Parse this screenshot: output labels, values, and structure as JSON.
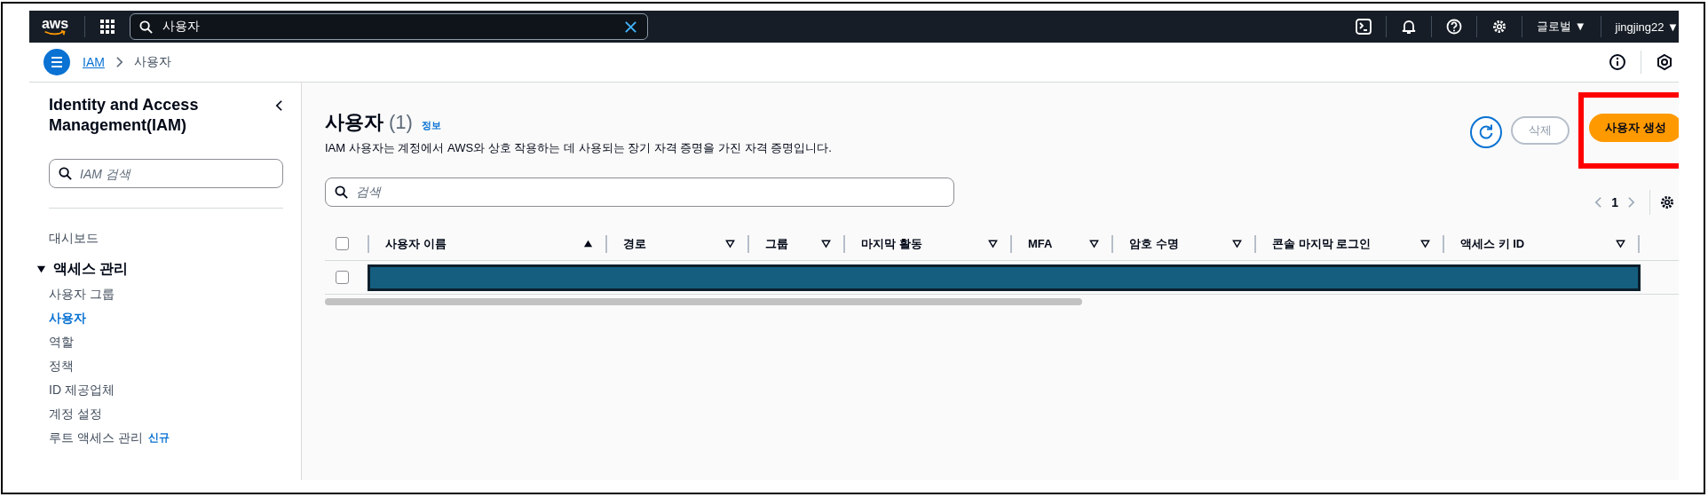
{
  "top_bar": {
    "logo": "aws",
    "search": {
      "value": "사용자"
    },
    "region": "글로벌 ▼",
    "user": "jingjing22 ▼"
  },
  "breadcrumb": {
    "items": [
      {
        "label": "IAM",
        "link": true
      },
      {
        "label": "사용자",
        "link": false
      }
    ]
  },
  "sidebar": {
    "title": "Identity and Access Management(IAM)",
    "search": {
      "placeholder": "IAM 검색"
    },
    "items": [
      {
        "label": "대시보드",
        "kind": "item",
        "selected": false
      },
      {
        "label": "액세스 관리",
        "kind": "section",
        "expanded": true,
        "children": [
          {
            "label": "사용자 그룹",
            "selected": false
          },
          {
            "label": "사용자",
            "selected": true
          },
          {
            "label": "역할",
            "selected": false
          },
          {
            "label": "정책",
            "selected": false
          },
          {
            "label": "ID 제공업체",
            "selected": false
          },
          {
            "label": "계정 설정",
            "selected": false
          },
          {
            "label": "루트 액세스 관리",
            "selected": false,
            "badge": "신규"
          }
        ]
      }
    ]
  },
  "header": {
    "title": "사용자",
    "count": "(1)",
    "info_link": "정보",
    "description": "IAM 사용자는 계정에서 AWS와 상호 작용하는 데 사용되는 장기 자격 증명을 가진 자격 증명입니다."
  },
  "actions": [
    {
      "kind": "refresh"
    },
    {
      "kind": "button",
      "label": "삭제",
      "disabled": true
    },
    {
      "kind": "primary",
      "label": "사용자 생성",
      "highlighted": true
    }
  ],
  "search": {
    "placeholder": "검색"
  },
  "pagination": {
    "page": "1"
  },
  "table": {
    "columns": [
      {
        "label": "사용자 이름",
        "sorted": true
      },
      {
        "label": "경로",
        "sorted": false
      },
      {
        "label": "그룹",
        "sorted": false
      },
      {
        "label": "마지막 활동",
        "sorted": false
      },
      {
        "label": "MFA",
        "sorted": false
      },
      {
        "label": "암호 수명",
        "sorted": false
      },
      {
        "label": "콘솔 마지막 로그인",
        "sorted": false
      },
      {
        "label": "액세스 키 ID",
        "sorted": false
      }
    ],
    "all_checked": false,
    "rows": [
      {
        "checked": false,
        "redacted": true
      }
    ]
  }
}
